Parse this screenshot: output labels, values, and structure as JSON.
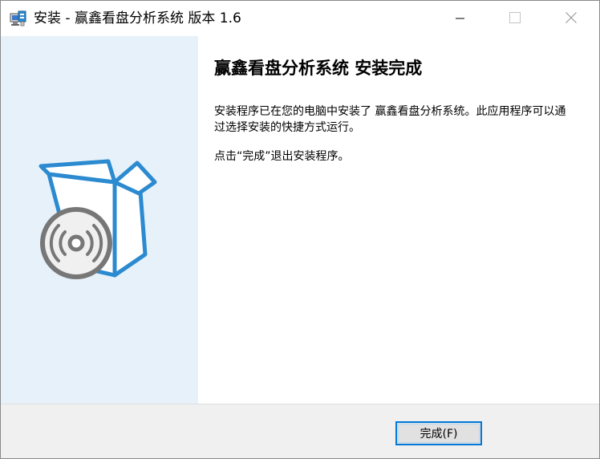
{
  "window": {
    "title": "安装 - 赢鑫看盘分析系统 版本 1.6",
    "app_icon": "installer-computer-icon",
    "minimize_icon": "minimize-icon",
    "maximize_icon": "maximize-icon",
    "close_icon": "close-icon"
  },
  "sidebar": {
    "graphic": "software-box-disc-icon",
    "colors": {
      "background": "#e7f1f9",
      "box": "#2b8ad0",
      "disc": "#777777"
    }
  },
  "main": {
    "heading": "赢鑫看盘分析系统 安装完成",
    "paragraph1": "安装程序已在您的电脑中安装了 赢鑫看盘分析系统。此应用程序可以通过选择安装的快捷方式运行。",
    "paragraph2": "点击“完成”退出安装程序。"
  },
  "footer": {
    "finish_label": "完成(F)",
    "accent": "#0078d7"
  }
}
